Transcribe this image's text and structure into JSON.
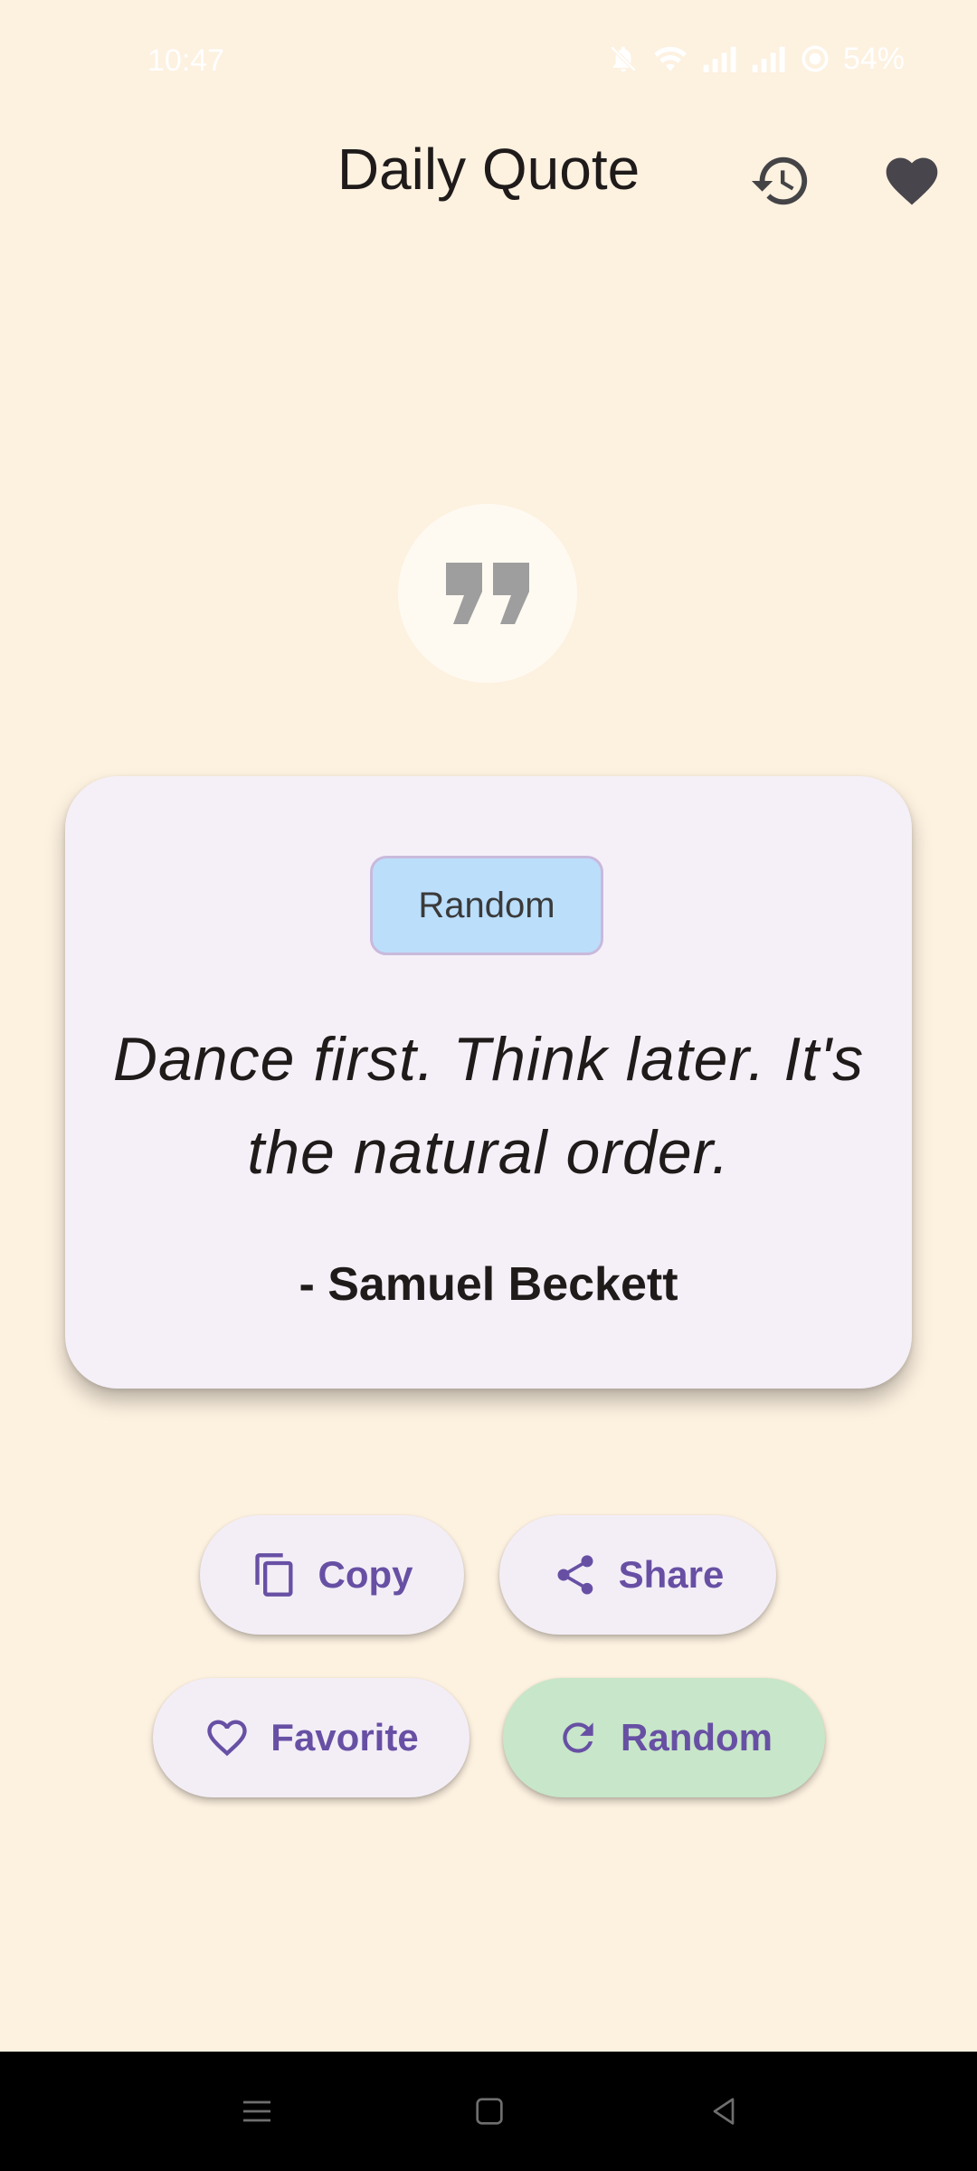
{
  "status_bar": {
    "time": "10:47",
    "battery": "54%",
    "icons": [
      "bell-off-icon",
      "wifi-icon",
      "signal-icon",
      "signal-icon",
      "battery-saver-icon"
    ]
  },
  "header": {
    "title": "Daily Quote",
    "history_icon": "history-icon",
    "favorites_icon": "heart-filled-icon"
  },
  "quote_icon": "format-quote-icon",
  "quote": {
    "category": "Random",
    "text": "Dance first. Think later. It's the natural order.",
    "author": "- Samuel Beckett"
  },
  "actions": {
    "copy": "Copy",
    "share": "Share",
    "favorite": "Favorite",
    "random": "Random"
  },
  "nav_bar": {
    "icons": [
      "menu-icon",
      "home-icon",
      "back-icon"
    ]
  },
  "colors": {
    "background": "#fdf1e0",
    "card": "#f5f0f7",
    "chip": "#bbdefb",
    "accent": "#6750a4",
    "random_button": "#c8e6c9"
  }
}
